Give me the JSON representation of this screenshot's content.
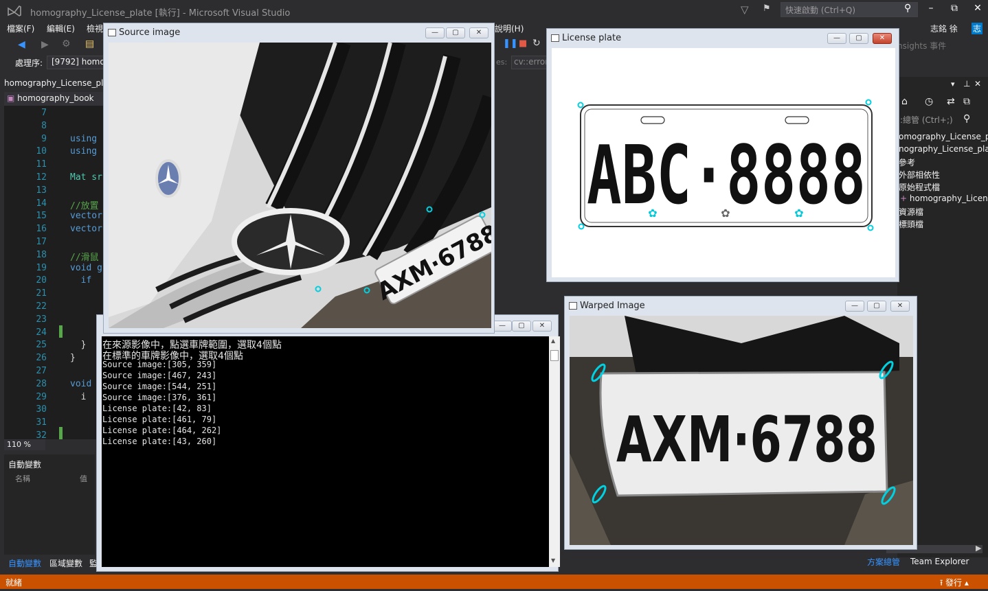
{
  "app": {
    "title": "homography_License_plate [執行] - Microsoft Visual Studio",
    "quick_launch_placeholder": "快速啟動 (Ctrl+Q)",
    "user": "志銘 徐",
    "user_badge": "志"
  },
  "menu": [
    "檔案(F)",
    "編輯(E)",
    "檢視",
    "說明(H)"
  ],
  "toolbar": {
    "process_label": "處理序:",
    "process_value": "[9792] homo",
    "insights": "nsights 事件",
    "cv_error": "cv::error"
  },
  "editor": {
    "doc_tab": "homography_License_pla",
    "nav_combo": "homography_book",
    "zoom": "110 %",
    "lines": [
      {
        "n": "7",
        "code": ""
      },
      {
        "n": "8",
        "code": ""
      },
      {
        "n": "9",
        "code": "using r"
      },
      {
        "n": "10",
        "code": "using r"
      },
      {
        "n": "11",
        "code": ""
      },
      {
        "n": "12",
        "code": "Mat sr"
      },
      {
        "n": "13",
        "code": ""
      },
      {
        "n": "14",
        "code": "//放置"
      },
      {
        "n": "15",
        "code": "vector"
      },
      {
        "n": "16",
        "code": "vector"
      },
      {
        "n": "17",
        "code": ""
      },
      {
        "n": "18",
        "code": "//滑鼠"
      },
      {
        "n": "19",
        "code": "void g"
      },
      {
        "n": "20",
        "code": "  if"
      },
      {
        "n": "21",
        "code": ""
      },
      {
        "n": "22",
        "code": ""
      },
      {
        "n": "23",
        "code": ""
      },
      {
        "n": "24",
        "code": ""
      },
      {
        "n": "25",
        "code": "  }"
      },
      {
        "n": "26",
        "code": "}"
      },
      {
        "n": "27",
        "code": ""
      },
      {
        "n": "28",
        "code": "void"
      },
      {
        "n": "29",
        "code": "  i"
      },
      {
        "n": "30",
        "code": ""
      },
      {
        "n": "31",
        "code": ""
      },
      {
        "n": "32",
        "code": ""
      }
    ]
  },
  "autos": {
    "title": "自動變數",
    "col_name": "名稱",
    "col_value": "值",
    "tabs": [
      "自動變數",
      "區域變數",
      "監"
    ]
  },
  "solution_explorer": {
    "search_placeholder": ":總管 (Ctrl+;)",
    "items": [
      "omography_License_p",
      "nography_License_pla",
      "參考",
      "外部相依性",
      "原始程式檔",
      "homography_Licen",
      "資源檔",
      "標頭檔"
    ],
    "tab_solution": "方案總管",
    "tab_team": "Team Explorer"
  },
  "status": {
    "ready": "就緒",
    "publish": "發行"
  },
  "windows": {
    "source": {
      "title": "Source image",
      "plate_text": "AXM·6788"
    },
    "license": {
      "title": "License plate",
      "plate_text": "ABC·8888"
    },
    "warped": {
      "title": "Warped Image",
      "plate_text": "AXM·6788"
    }
  },
  "console": {
    "lines": [
      "在來源影像中，點選車牌範圍，選取4個點",
      "在標準的車牌影像中，選取4個點",
      "Source image:[305, 359]",
      "Source image:[467, 243]",
      "Source image:[544, 251]",
      "Source image:[376, 361]",
      "License plate:[42, 83]",
      "License plate:[461, 79]",
      "License plate:[464, 262]",
      "License plate:[43, 260]"
    ]
  },
  "colors": {
    "vs_bg": "#2d2d30",
    "status_orange": "#ca5100",
    "marker_cyan": "#00d0e0"
  }
}
